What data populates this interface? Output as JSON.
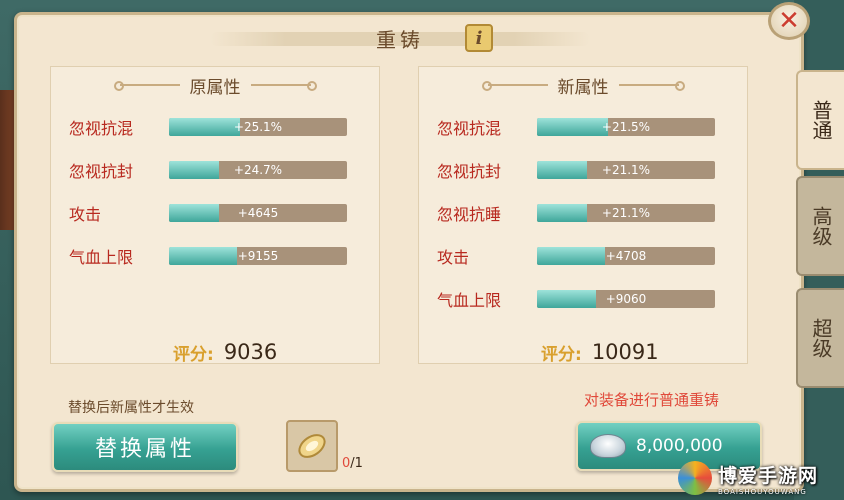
{
  "dialog": {
    "title": "重铸",
    "info_label": "i",
    "close_label": "✕"
  },
  "original": {
    "heading": "原属性",
    "stats": [
      {
        "name": "忽视抗混",
        "value": "+25.1%",
        "fill": 0.4
      },
      {
        "name": "忽视抗封",
        "value": "+24.7%",
        "fill": 0.28
      },
      {
        "name": "攻击",
        "value": "+4645",
        "fill": 0.28
      },
      {
        "name": "气血上限",
        "value": "+9155",
        "fill": 0.38
      }
    ],
    "score_label": "评分:",
    "score": "9036"
  },
  "new": {
    "heading": "新属性",
    "stats": [
      {
        "name": "忽视抗混",
        "value": "+21.5%",
        "fill": 0.4
      },
      {
        "name": "忽视抗封",
        "value": "+21.1%",
        "fill": 0.28
      },
      {
        "name": "忽视抗睡",
        "value": "+21.1%",
        "fill": 0.28
      },
      {
        "name": "攻击",
        "value": "+4708",
        "fill": 0.38
      },
      {
        "name": "气血上限",
        "value": "+9060",
        "fill": 0.33
      }
    ],
    "score_label": "评分:",
    "score": "10091"
  },
  "footer": {
    "replace_hint": "替换后新属性才生效",
    "replace_button": "替换属性",
    "material_have": "0",
    "material_need": "/1",
    "reforge_hint": "对装备进行普通重铸",
    "cost": "8,000,000"
  },
  "tabs": [
    {
      "label": "普通",
      "active": true
    },
    {
      "label": "高级",
      "active": false
    },
    {
      "label": "超级",
      "active": false
    }
  ],
  "watermark": {
    "main": "博爱手游网",
    "sub": "BOAISHOUYOUWANG"
  },
  "icons": {
    "info": "info-icon",
    "close": "close-icon",
    "material": "reforge-stone-icon",
    "currency": "silver-ingot-icon"
  }
}
